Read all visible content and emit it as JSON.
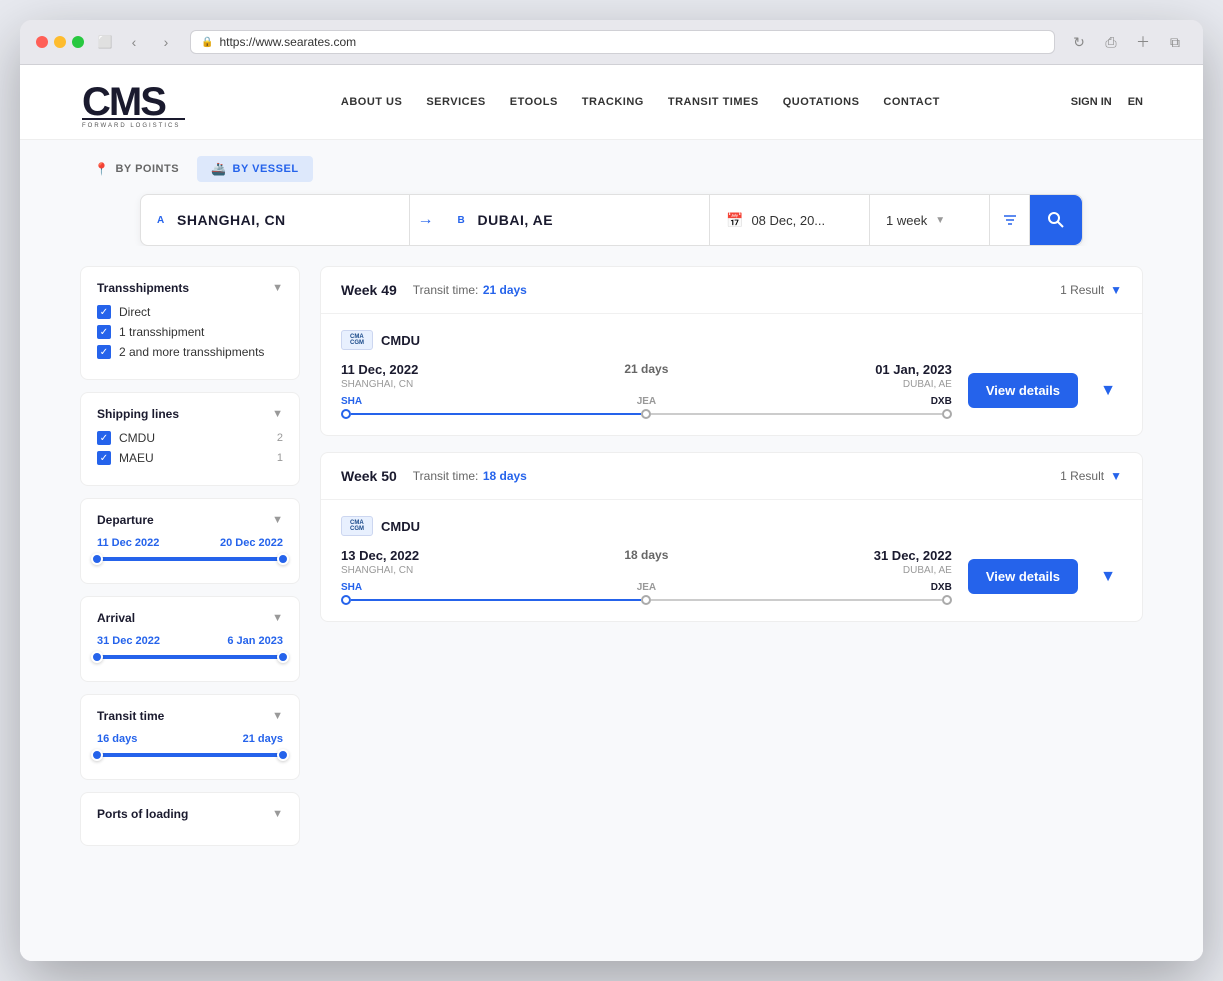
{
  "browser": {
    "url": "https://www.searates.com"
  },
  "header": {
    "logo": "CMS",
    "logo_sub": "FORWARD LOGISTICS",
    "nav_items": [
      "ABOUT US",
      "SERVICES",
      "ETOOLS",
      "TRACKING",
      "TRANSIT TIMES",
      "QUOTATIONS",
      "CONTACT"
    ],
    "sign_in": "SIGN IN",
    "lang": "EN"
  },
  "search": {
    "tab_points": "BY POINTS",
    "tab_vessel": "BY VESSEL",
    "origin_label": "A",
    "origin_value": "SHANGHAI, CN",
    "dest_label": "B",
    "dest_value": "DUBAI, AE",
    "date_value": "08 Dec, 20...",
    "week_value": "1 week",
    "arrow": "→"
  },
  "filters": {
    "transshipments": {
      "title": "Transshipments",
      "options": [
        {
          "label": "Direct",
          "checked": true
        },
        {
          "label": "1 transshipment",
          "checked": true
        },
        {
          "label": "2 and more transshipments",
          "checked": true
        }
      ]
    },
    "shipping_lines": {
      "title": "Shipping lines",
      "options": [
        {
          "label": "CMDU",
          "count": "2",
          "checked": true
        },
        {
          "label": "MAEU",
          "count": "1",
          "checked": true
        }
      ]
    },
    "departure": {
      "title": "Departure",
      "min": "11 Dec 2022",
      "max": "20 Dec 2022",
      "min_pct": 0,
      "max_pct": 100
    },
    "arrival": {
      "title": "Arrival",
      "min": "31 Dec 2022",
      "max": "6 Jan 2023",
      "min_pct": 0,
      "max_pct": 100
    },
    "transit_time": {
      "title": "Transit time",
      "min": "16 days",
      "max": "21 days",
      "min_pct": 0,
      "max_pct": 100
    },
    "ports_loading": {
      "title": "Ports of loading"
    }
  },
  "results": [
    {
      "week": "Week 49",
      "transit_label": "Transit time:",
      "transit_days": "21 days",
      "result_count": "1  Result",
      "items": [
        {
          "carrier": "CMDU",
          "departure_date": "11 Dec, 2022",
          "departure_port": "SHANGHAI, CN",
          "transit_days": "21 days",
          "arrival_date": "01 Jan, 2023",
          "arrival_port": "DUBAI, AE",
          "port_from": "SHA",
          "port_mid": "JEA",
          "port_to": "DXB",
          "btn_label": "View details"
        }
      ]
    },
    {
      "week": "Week 50",
      "transit_label": "Transit time:",
      "transit_days": "18 days",
      "result_count": "1  Result",
      "items": [
        {
          "carrier": "CMDU",
          "departure_date": "13 Dec, 2022",
          "departure_port": "SHANGHAI, CN",
          "transit_days": "18 days",
          "arrival_date": "31 Dec, 2022",
          "arrival_port": "DUBAI, AE",
          "port_from": "SHA",
          "port_mid": "JEA",
          "port_to": "DXB",
          "btn_label": "View details"
        }
      ]
    }
  ]
}
